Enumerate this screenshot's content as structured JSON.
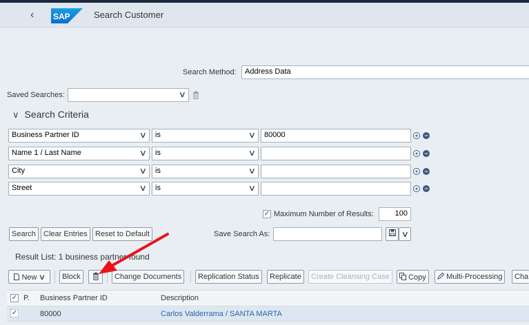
{
  "shell": {
    "title": "Search Customer",
    "logo_text": "SAP"
  },
  "search": {
    "method_label": "Search Method:",
    "method_value": "Address Data",
    "saved_label": "Saved Searches:",
    "saved_value": "",
    "section_title": "Search Criteria",
    "criteria": [
      {
        "field": "Business Partner ID",
        "op": "is",
        "value": "80000"
      },
      {
        "field": "Name 1 / Last Name",
        "op": "is",
        "value": ""
      },
      {
        "field": "City",
        "op": "is",
        "value": ""
      },
      {
        "field": "Street",
        "op": "is",
        "value": ""
      }
    ],
    "max_results_label": "Maximum Number of Results:",
    "max_results_checked": true,
    "max_results_value": "100",
    "buttons": {
      "search": "Search",
      "clear": "Clear Entries",
      "reset": "Reset to Default"
    },
    "save_as_label": "Save Search As:",
    "save_as_value": ""
  },
  "results": {
    "title": "Result List: 1 business partner found",
    "toolbar": {
      "new": "New",
      "block": "Block",
      "change_documents": "Change Documents",
      "replication_status": "Replication Status",
      "replicate": "Replicate",
      "create_cleansing_case": "Create Cleansing Case",
      "copy": "Copy",
      "multi_processing": "Multi-Processing",
      "overflow": "Cha"
    },
    "columns": {
      "p": "P.",
      "bp_id": "Business Partner ID",
      "description": "Description"
    },
    "rows": [
      {
        "bp_id": "80000",
        "description": "Carlos Valderrama / SANTA MARTA"
      }
    ]
  },
  "colors": {
    "accent": "#2a66a8",
    "shell": "#dfe6ee",
    "arrow": "#e8141c"
  }
}
